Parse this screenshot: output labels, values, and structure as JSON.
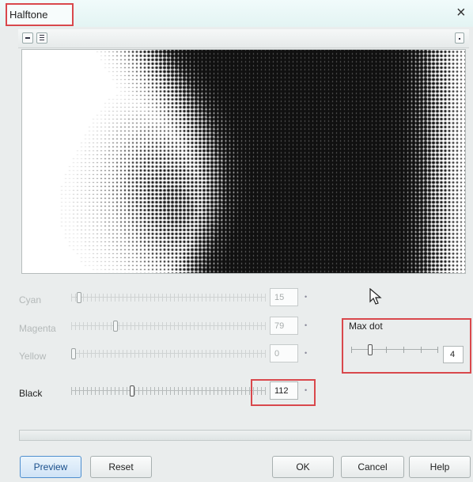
{
  "window": {
    "title": "Halftone",
    "close_glyph": "×"
  },
  "toolbar": {
    "icons": [
      "single-view-icon",
      "split-view-icon",
      "options-icon"
    ]
  },
  "channels": [
    {
      "label": "Cyan",
      "value": "15",
      "active": false,
      "level": 0.03
    },
    {
      "label": "Magenta",
      "value": "79",
      "active": false,
      "level": 0.22
    },
    {
      "label": "Yellow",
      "value": "0",
      "active": false,
      "level": 0.0
    },
    {
      "label": "Black",
      "value": "112",
      "active": true,
      "level": 0.31
    }
  ],
  "max_dot": {
    "label": "Max dot",
    "value": "4",
    "level": 0.2
  },
  "spin_glyph": "•",
  "buttons": {
    "preview": "Preview",
    "reset": "Reset",
    "ok": "OK",
    "cancel": "Cancel",
    "help": "Help"
  },
  "colors": {
    "highlight": "#d9484c",
    "accent": "#4f8fcf"
  }
}
